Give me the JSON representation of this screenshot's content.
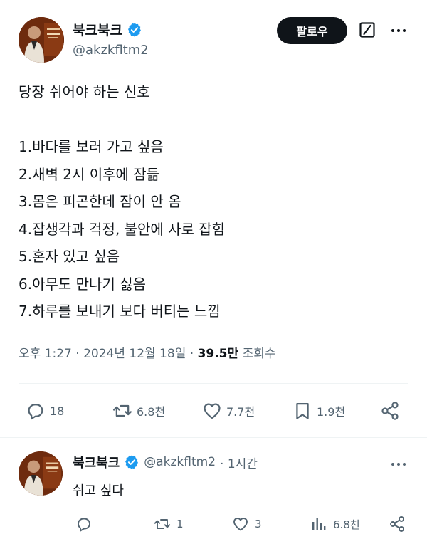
{
  "tweet": {
    "author": {
      "display_name": "북크북크",
      "handle": "@akzkfltm2",
      "verified_icon": "verified-badge-icon"
    },
    "follow_label": "팔로우",
    "lines": [
      "당장 쉬어야 하는 신호",
      "",
      "1.바다를 보러 가고 싶음",
      "2.새벽 2시 이후에 잠듦",
      "3.몸은 피곤한데 잠이 안 옴",
      "4.잡생각과 걱정, 불안에 사로 잡힘",
      "5.혼자 있고 싶음",
      "6.아무도 만나기 싫음",
      "7.하루를 보내기 보다 버티는 느낌"
    ],
    "time": "오후 1:27",
    "separator": "·",
    "date": "2024년 12월 18일",
    "views_count": "39.5만",
    "views_label": "조회수",
    "actions": {
      "replies": "18",
      "reposts": "6.8천",
      "likes": "7.7천",
      "bookmarks": "1.9천"
    }
  },
  "reply": {
    "author": {
      "display_name": "북크북크",
      "handle": "@akzkfltm2",
      "time": "· 1시간"
    },
    "text": "쉬고 싶다",
    "actions": {
      "replies": "",
      "reposts": "1",
      "likes": "3",
      "views": "6.8천"
    }
  },
  "colors": {
    "text": "#0f1419",
    "secondary": "#536471",
    "verified": "#1d9bf0",
    "button": "#0f1419",
    "divider": "#eff3f4"
  }
}
